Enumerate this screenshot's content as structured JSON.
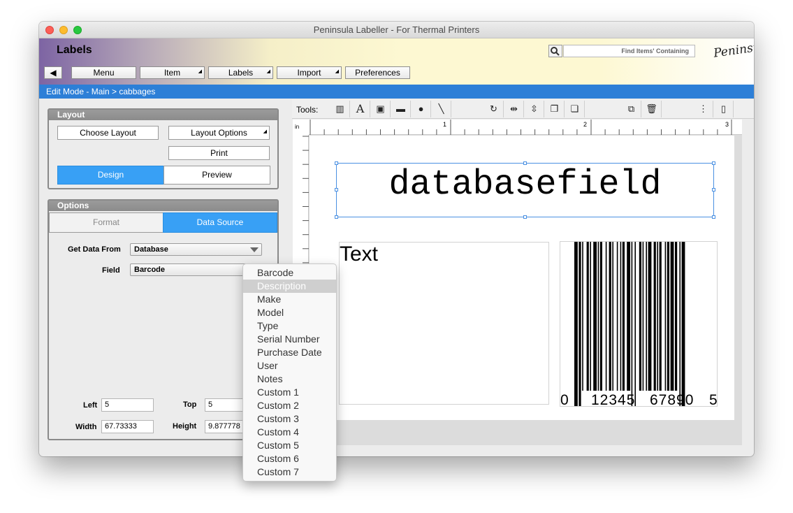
{
  "window": {
    "title": "Peninsula Labeller - For Thermal Printers"
  },
  "header": {
    "app_title": "Labels",
    "search_placeholder": "Find Items' Containing",
    "logo_text": "Peninsula",
    "nav": {
      "back": "◀",
      "menu": "Menu",
      "item": "Item",
      "labels": "Labels",
      "import": "Import",
      "preferences": "Preferences"
    }
  },
  "breadcrumb": "Edit Mode - Main > cabbages",
  "layout_panel": {
    "title": "Layout",
    "choose_layout": "Choose Layout",
    "layout_options": "Layout Options",
    "print": "Print",
    "design": "Design",
    "preview": "Preview",
    "active_mode": "Design"
  },
  "options_panel": {
    "title": "Options",
    "tabs": {
      "format": "Format",
      "data_source": "Data Source"
    },
    "active_tab": "Data Source",
    "get_data_from_label": "Get Data From",
    "get_data_from_value": "Database",
    "field_label": "Field",
    "field_value": "Barcode",
    "left_label": "Left",
    "left_value": "5",
    "top_label": "Top",
    "top_value": "5",
    "width_label": "Width",
    "width_value": "67.73333",
    "height_label": "Height",
    "height_value": "9.877778"
  },
  "toolbar": {
    "label": "Tools:"
  },
  "ruler": {
    "unit": "in",
    "marks": [
      "1",
      "2",
      "3"
    ]
  },
  "canvas": {
    "db_field_text": "databasefield",
    "text_box": "Text",
    "barcode_digits": {
      "first": "0",
      "left": "12345",
      "right": "67890",
      "last": "5"
    }
  },
  "field_menu": {
    "items": [
      "Barcode",
      "Description",
      "Make",
      "Model",
      "Type",
      "Serial Number",
      "Purchase Date",
      "User",
      "Notes",
      "Custom 1",
      "Custom 2",
      "Custom 3",
      "Custom 4",
      "Custom 5",
      "Custom 6",
      "Custom 7"
    ],
    "highlighted": "Description"
  },
  "colors": {
    "accent": "#2d7fd7",
    "selected_tab": "#38a0f5",
    "header_purple": "#7d64a3"
  }
}
